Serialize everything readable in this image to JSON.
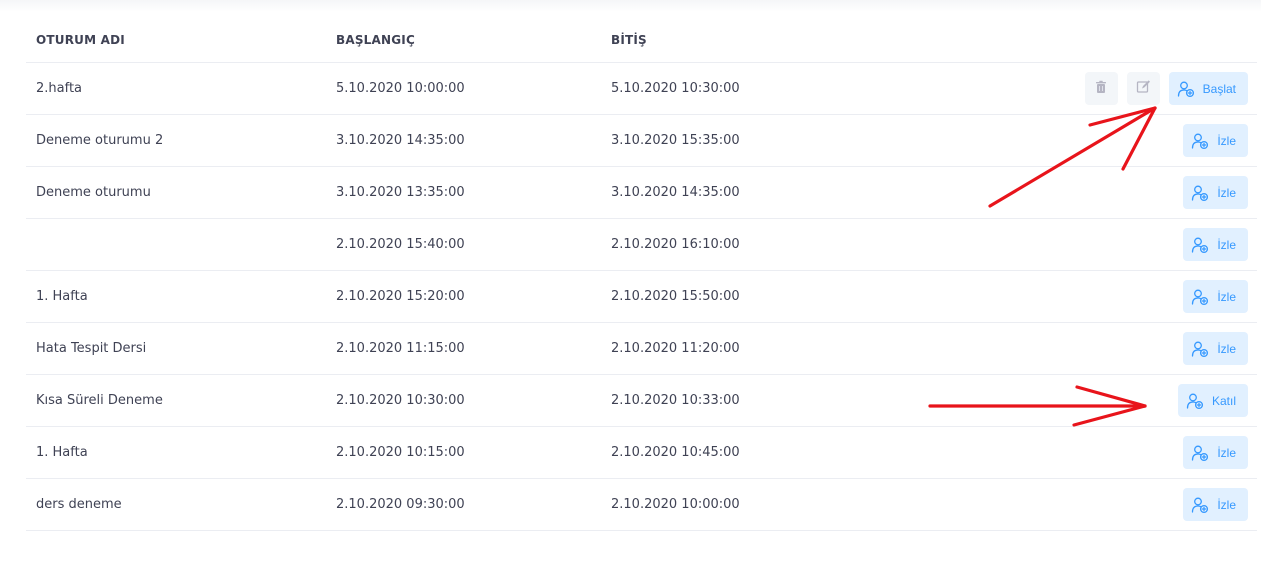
{
  "table": {
    "headers": {
      "name": "OTURUM ADI",
      "start": "BAŞLANGIÇ",
      "end": "BİTİŞ"
    },
    "rows": [
      {
        "name": "2.hafta",
        "start": "5.10.2020 10:00:00",
        "end": "5.10.2020 10:30:00",
        "action": "Başlat",
        "owner_actions": true
      },
      {
        "name": "Deneme oturumu 2",
        "start": "3.10.2020 14:35:00",
        "end": "3.10.2020 15:35:00",
        "action": "İzle"
      },
      {
        "name": "Deneme oturumu",
        "start": "3.10.2020 13:35:00",
        "end": "3.10.2020 14:35:00",
        "action": "İzle"
      },
      {
        "name": "",
        "start": "2.10.2020 15:40:00",
        "end": "2.10.2020 16:10:00",
        "action": "İzle"
      },
      {
        "name": "1. Hafta",
        "start": "2.10.2020 15:20:00",
        "end": "2.10.2020 15:50:00",
        "action": "İzle"
      },
      {
        "name": "Hata Tespit Dersi",
        "start": "2.10.2020 11:15:00",
        "end": "2.10.2020 11:20:00",
        "action": "İzle"
      },
      {
        "name": "Kısa Süreli Deneme",
        "start": "2.10.2020 10:30:00",
        "end": "2.10.2020 10:33:00",
        "action": "Katıl"
      },
      {
        "name": "1. Hafta",
        "start": "2.10.2020 10:15:00",
        "end": "2.10.2020 10:45:00",
        "action": "İzle"
      },
      {
        "name": "ders deneme",
        "start": "2.10.2020 09:30:00",
        "end": "2.10.2020 10:00:00",
        "action": "İzle"
      }
    ]
  },
  "icons": {
    "delete": "trash-icon",
    "edit": "edit-icon",
    "action": "user-add-icon"
  },
  "colors": {
    "accent": "#3699ff",
    "accent_light": "#e1f0ff",
    "annotation_arrow": "#e8141b"
  }
}
